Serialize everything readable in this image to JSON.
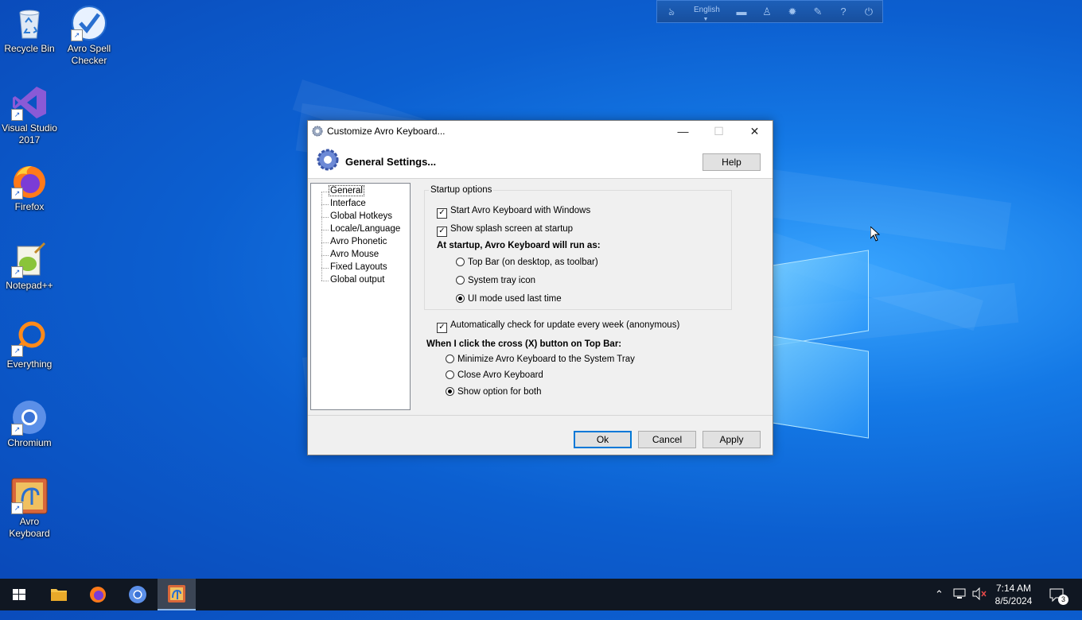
{
  "desktop": {
    "icons": [
      {
        "label": "Recycle Bin"
      },
      {
        "label": "Avro Spell Checker"
      },
      {
        "label": "Visual Studio 2017"
      },
      {
        "label": "Firefox"
      },
      {
        "label": "Notepad++"
      },
      {
        "label": "Everything"
      },
      {
        "label": "Chromium"
      },
      {
        "label": "Avro Keyboard"
      }
    ]
  },
  "avro_topbar": {
    "language": "English"
  },
  "dialog": {
    "title": "Customize Avro Keyboard...",
    "header_title": "General Settings...",
    "help_label": "Help",
    "tree": [
      "General",
      "Interface",
      "Global Hotkeys",
      "Locale/Language",
      "Avro Phonetic",
      "Avro Mouse",
      "Fixed Layouts",
      "Global output"
    ],
    "selected_tree_item": "General",
    "startup_group": {
      "legend": "Startup options",
      "start_with_windows": {
        "label": "Start Avro Keyboard with Windows",
        "checked": true
      },
      "show_splash": {
        "label": "Show splash screen at startup",
        "checked": true
      },
      "run_as_heading": "At startup, Avro Keyboard will run as:",
      "run_as_options": [
        {
          "label": "Top Bar (on desktop, as toolbar)",
          "selected": false
        },
        {
          "label": "System tray icon",
          "selected": false
        },
        {
          "label": "UI mode used last time",
          "selected": true
        }
      ]
    },
    "auto_update": {
      "label": "Automatically check for update every week (anonymous)",
      "checked": true
    },
    "cross_heading": "When I click the cross (X) button on Top Bar:",
    "cross_options": [
      {
        "label": "Minimize Avro Keyboard to the System Tray",
        "selected": false
      },
      {
        "label": "Close Avro Keyboard",
        "selected": false
      },
      {
        "label": "Show option for both",
        "selected": true
      }
    ],
    "ok_label": "Ok",
    "cancel_label": "Cancel",
    "apply_label": "Apply"
  },
  "taskbar": {
    "time": "7:14 AM",
    "date": "8/5/2024",
    "notification_count": "3"
  }
}
